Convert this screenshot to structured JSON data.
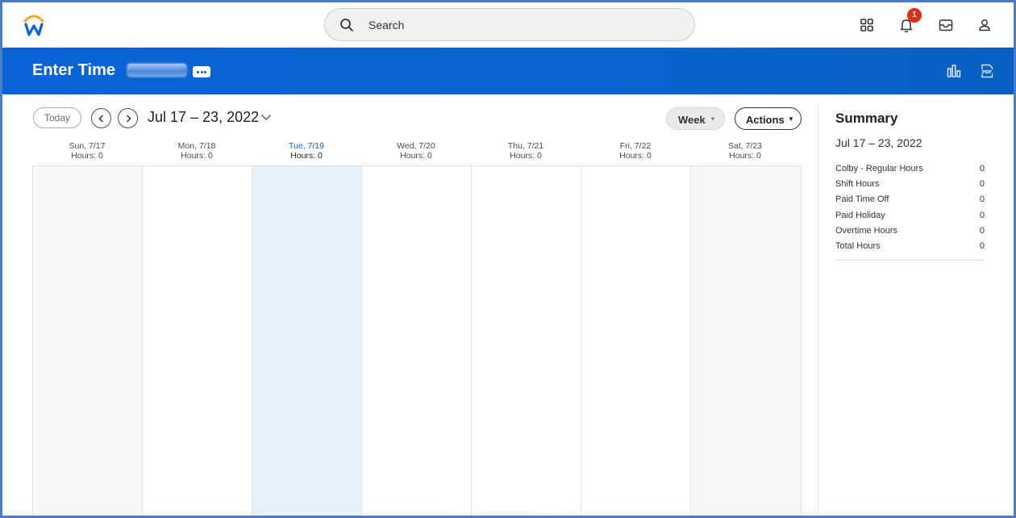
{
  "search": {
    "placeholder": "Search"
  },
  "notifications": {
    "count": "1"
  },
  "header": {
    "title": "Enter Time"
  },
  "toolbar": {
    "today_label": "Today",
    "date_range": "Jul 17 – 23, 2022",
    "view_label": "Week",
    "actions_label": "Actions"
  },
  "days": [
    {
      "label": "Sun, 7/17",
      "hours": "Hours: 0"
    },
    {
      "label": "Mon, 7/18",
      "hours": "Hours: 0"
    },
    {
      "label": "Tue, 7/19",
      "hours": "Hours: 0"
    },
    {
      "label": "Wed, 7/20",
      "hours": "Hours: 0"
    },
    {
      "label": "Thu, 7/21",
      "hours": "Hours: 0"
    },
    {
      "label": "Fri, 7/22",
      "hours": "Hours: 0"
    },
    {
      "label": "Sat, 7/23",
      "hours": "Hours: 0"
    }
  ],
  "summary": {
    "title": "Summary",
    "range": "Jul 17 – 23, 2022",
    "rows": [
      {
        "label": "Colby - Regular Hours",
        "value": "0"
      },
      {
        "label": "Shift Hours",
        "value": "0"
      },
      {
        "label": "Paid Time Off",
        "value": "0"
      },
      {
        "label": "Paid Holiday",
        "value": "0"
      },
      {
        "label": "Overtime Hours",
        "value": "0"
      },
      {
        "label": "Total Hours",
        "value": "0"
      }
    ]
  },
  "icons": {
    "logo": "workday-logo-icon",
    "apps": "apps-grid-icon",
    "notifications": "bell-icon",
    "inbox": "inbox-icon",
    "profile": "user-icon",
    "chart": "bar-chart-icon",
    "pdf": "pdf-icon"
  },
  "colors": {
    "brand_blue": "#0a63d6",
    "today_column": "#e6f1fc",
    "badge_red": "#de2e21"
  }
}
